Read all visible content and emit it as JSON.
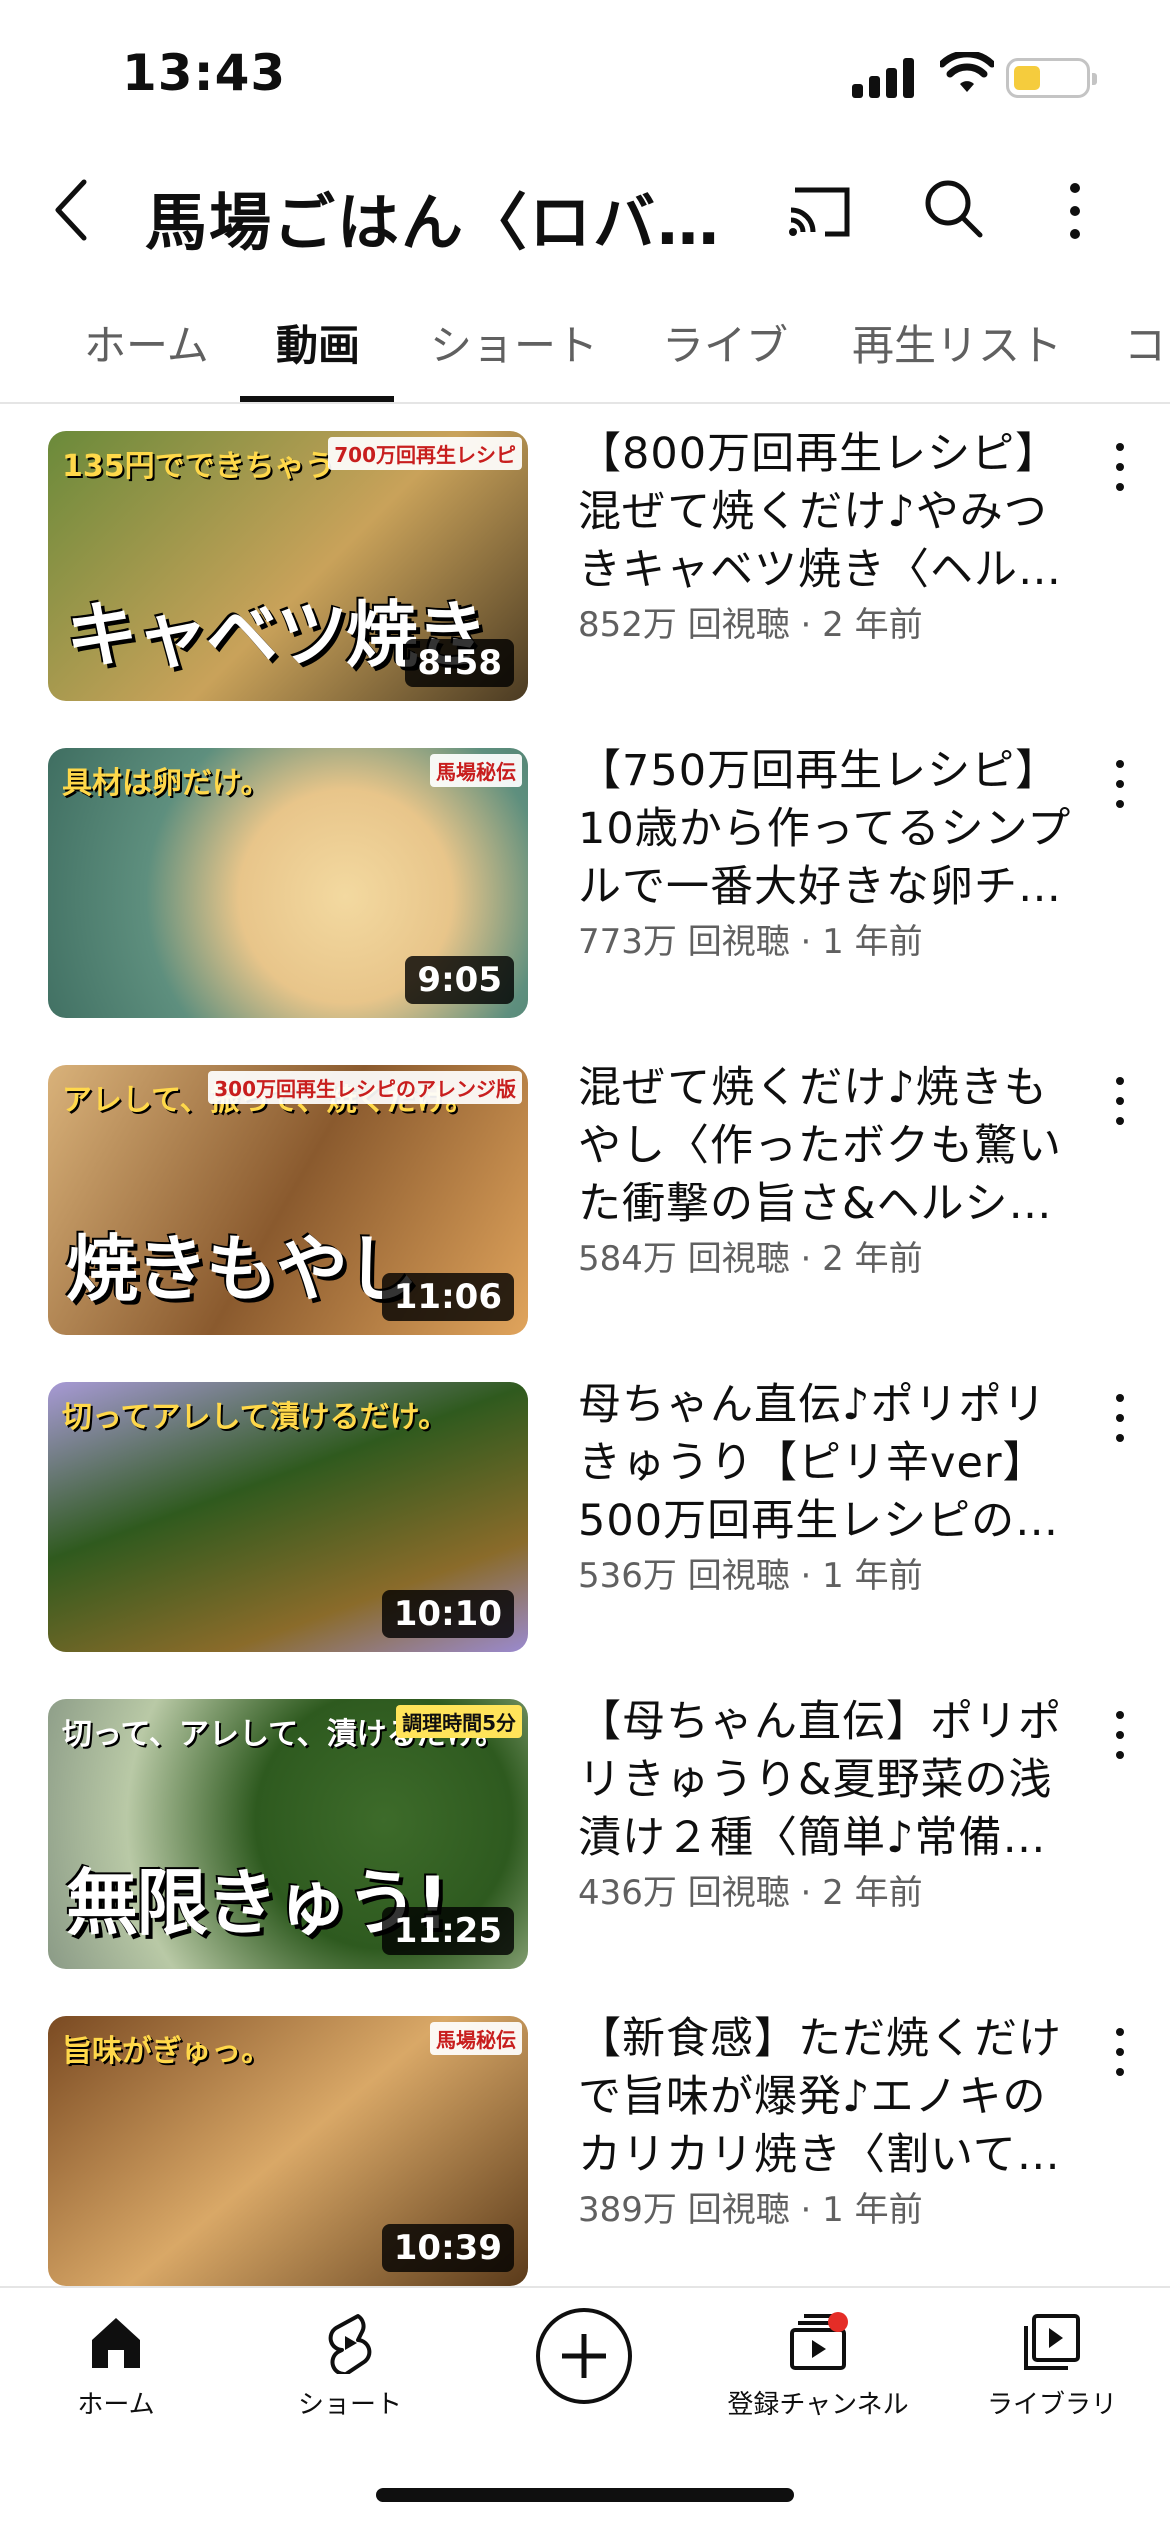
{
  "status_bar": {
    "time": "13:43"
  },
  "app_bar": {
    "channel_title": "馬場ごはん〈ロバ…"
  },
  "tabs": [
    {
      "label": "ホーム"
    },
    {
      "label": "動画"
    },
    {
      "label": "ショート"
    },
    {
      "label": "ライブ"
    },
    {
      "label": "再生リスト"
    },
    {
      "label": "コミ"
    }
  ],
  "videos": [
    {
      "title": "【800万回再生レシピ】混ぜて焼くだけ♪やみつきキャベツ焼き〈ヘルシ…",
      "meta": "852万 回視聴 · 2 年前",
      "duration": "8:58",
      "thumb_main": "キャベツ焼き",
      "thumb_top": "135円でできちゃう",
      "thumb_tag": "700万回再生レシピ",
      "thumb_colors": [
        "#6a8a3a",
        "#c9a25a"
      ]
    },
    {
      "title": "【750万回再生レシピ】10歳から作ってるシンプルで一番大好きな卵チ…",
      "meta": "773万 回視聴 · 1 年前",
      "duration": "9:05",
      "thumb_main": "",
      "thumb_top": "具材は卵だけ。",
      "thumb_tag": "馬場秘伝",
      "thumb_colors": [
        "#5e8f7e",
        "#e8c58a"
      ]
    },
    {
      "title": "混ぜて焼くだけ♪焼きもやし〈作ったボクも驚いた衝撃の旨さ&ヘルシ…",
      "meta": "584万 回視聴 · 2 年前",
      "duration": "11:06",
      "thumb_main": "焼きもやし",
      "thumb_top": "アレして、振って、焼くだけ。",
      "thumb_tag": "300万回再生レシピのアレンジ版",
      "thumb_colors": [
        "#8a5a2e",
        "#e0a45c"
      ]
    },
    {
      "title": "母ちゃん直伝♪ポリポリきゅうり【ピリ辛ver】500万回再生レシピの…",
      "meta": "536万 回視聴 · 1 年前",
      "duration": "10:10",
      "thumb_main": "",
      "thumb_top": "切ってアレして漬けるだけ。",
      "thumb_tag": "",
      "thumb_colors": [
        "#2f5a1e",
        "#8a6b2a"
      ]
    },
    {
      "title": "【母ちゃん直伝】ポリポリきゅうり&夏野菜の浅漬け２種〈簡単♪常備…",
      "meta": "436万 回視聴 · 2 年前",
      "duration": "11:25",
      "thumb_main": "無限きゅう!",
      "thumb_top": "切って、アレして、漬けるだけ。",
      "thumb_tag": "調理時間5分",
      "thumb_colors": [
        "#3d6b2a",
        "#b9c9a6"
      ]
    },
    {
      "title": "【新食感】ただ焼くだけで旨味が爆発♪エノキのカリカリ焼き〈割いて…",
      "meta": "389万 回視聴 · 1 年前",
      "duration": "10:39",
      "thumb_main": "",
      "thumb_top": "旨味がぎゅっ。",
      "thumb_tag": "馬場秘伝",
      "thumb_colors": [
        "#7a4a22",
        "#d9a867"
      ]
    }
  ],
  "bottom_nav": {
    "home": "ホーム",
    "shorts": "ショート",
    "subscriptions": "登録チャンネル",
    "library": "ライブラリ"
  }
}
